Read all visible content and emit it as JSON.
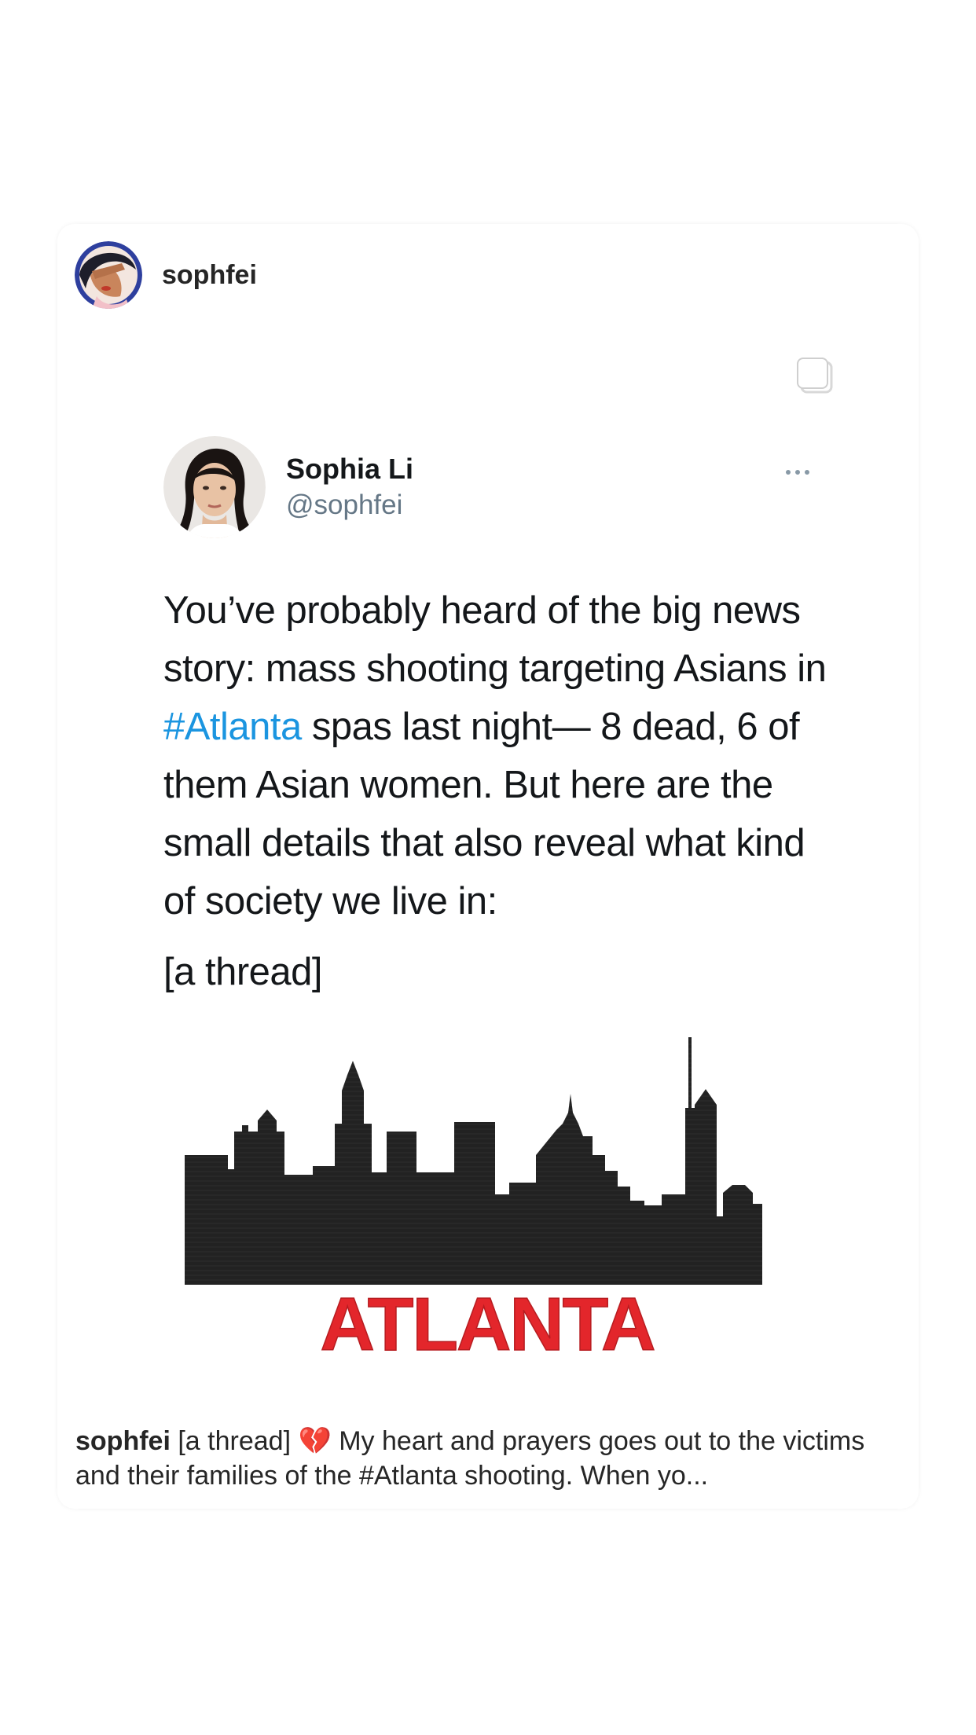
{
  "post": {
    "username": "sophfei"
  },
  "tweet": {
    "display_name": "Sophia Li",
    "handle": "@sophfei",
    "text_part1": "You’ve probably heard of the big news story: mass shooting targeting Asians in ",
    "hashtag": "#Atlanta",
    "text_part2": " spas last night— 8 dead, 6 of them Asian women. But here are the small details that also reveal what kind of society we live in:",
    "thread_label": "[a thread]",
    "image_word": "ATLANTA"
  },
  "caption": {
    "username": "sophfei",
    "text": "[a thread] 💔 My heart and prayers goes out to the victims and their families of the #Atlanta shooting. When yo..."
  },
  "icons": {
    "multi_image": "multiple-images-icon",
    "more": "more-options-icon"
  },
  "colors": {
    "hashtag": "#1b95e0",
    "skyline": "#222222",
    "atlanta_red": "#e3262b"
  }
}
